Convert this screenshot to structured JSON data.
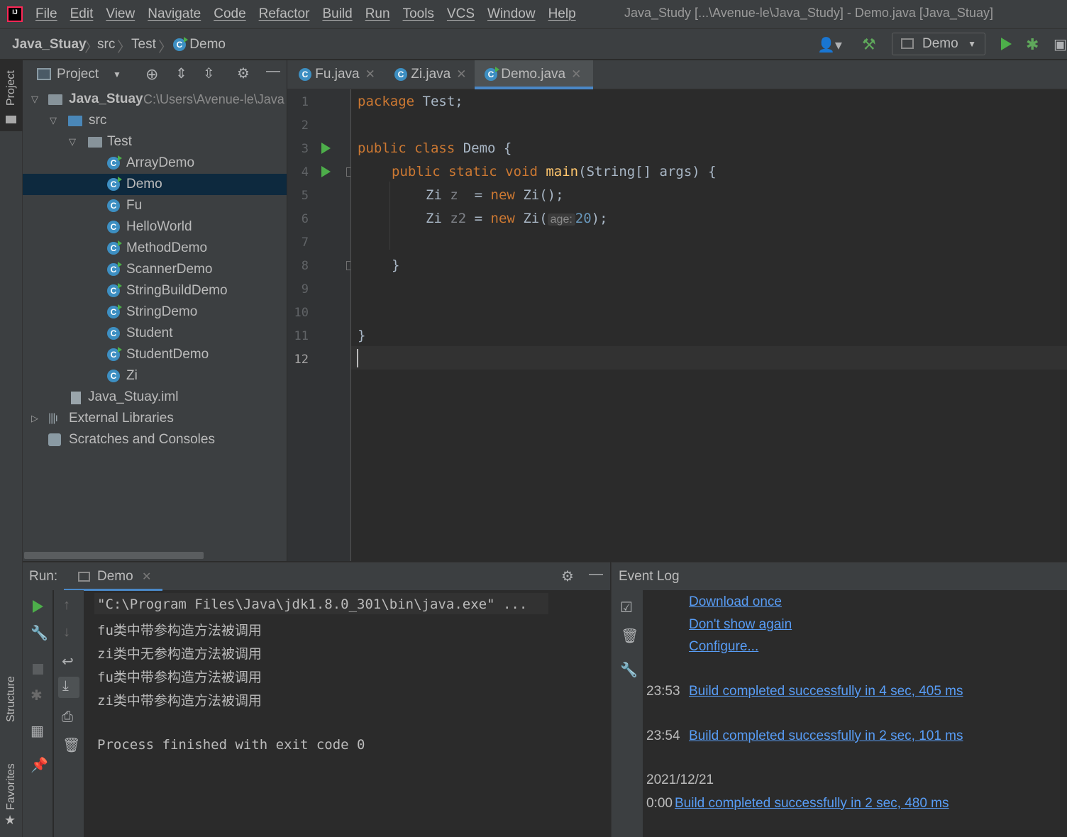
{
  "menu": {
    "items": [
      "File",
      "Edit",
      "View",
      "Navigate",
      "Code",
      "Refactor",
      "Build",
      "Run",
      "Tools",
      "VCS",
      "Window",
      "Help"
    ],
    "window_title": "Java_Study [...\\Avenue-le\\Java_Study] - Demo.java [Java_Stuay]"
  },
  "breadcrumb": {
    "project": "Java_Stuay",
    "src": "src",
    "pkg": "Test",
    "file": "Demo"
  },
  "toolbar": {
    "run_config": "Demo"
  },
  "left_strip": {
    "project": "Project",
    "structure": "Structure",
    "favorites": "Favorites"
  },
  "project_panel": {
    "title": "Project",
    "root_name": "Java_Stuay",
    "root_path": "C:\\Users\\Avenue-le\\Java",
    "src": "src",
    "pkg": "Test",
    "classes": [
      "ArrayDemo",
      "Demo",
      "Fu",
      "HelloWorld",
      "MethodDemo",
      "ScannerDemo",
      "StringBuildDemo",
      "StringDemo",
      "Student",
      "StudentDemo",
      "Zi"
    ],
    "iml": "Java_Stuay.iml",
    "external": "External Libraries",
    "scratches": "Scratches and Consoles"
  },
  "tabs": [
    {
      "label": "Fu.java"
    },
    {
      "label": "Zi.java"
    },
    {
      "label": "Demo.java"
    }
  ],
  "editor": {
    "line_numbers": [
      "1",
      "2",
      "3",
      "4",
      "5",
      "6",
      "7",
      "8",
      "9",
      "10",
      "11",
      "12"
    ],
    "l1_kw": "package",
    "l1_rest": " Test;",
    "l3_kw": "public class",
    "l3_rest": " Demo {",
    "l4_kw": "public static void",
    "l4_fn": "main",
    "l4_rest": "(String[] args) {",
    "l5_type": "Zi ",
    "l5_var": "z",
    "l5_eq": "  = ",
    "l5_kw": "new",
    "l5_rest": " Zi();",
    "l6_type": "Zi ",
    "l6_var": "z2",
    "l6_eq": " = ",
    "l6_kw": "new",
    "l6_call": " Zi(",
    "l6_hint": "age:",
    "l6_num": "20",
    "l6_end": ");",
    "l8": "}",
    "l11": "}"
  },
  "run_panel": {
    "label": "Run:",
    "tab": "Demo",
    "lines": [
      "\"C:\\Program Files\\Java\\jdk1.8.0_301\\bin\\java.exe\" ...",
      "fu类中带参构造方法被调用",
      "zi类中无参构造方法被调用",
      "fu类中带参构造方法被调用",
      "zi类中带参构造方法被调用",
      "",
      "Process finished with exit code 0"
    ]
  },
  "event_log": {
    "title": "Event Log",
    "links": [
      "Download once",
      "Don't show again",
      "Configure..."
    ],
    "entries": [
      {
        "time": "23:53",
        "text": "Build completed successfully in 4 sec, 405 ms"
      },
      {
        "time": "23:54",
        "text": "Build completed successfully in 2 sec, 101 ms"
      }
    ],
    "date": "2021/12/21",
    "last_time": "0:00",
    "last_text": "Build completed successfully in 2 sec, 480 ms"
  }
}
